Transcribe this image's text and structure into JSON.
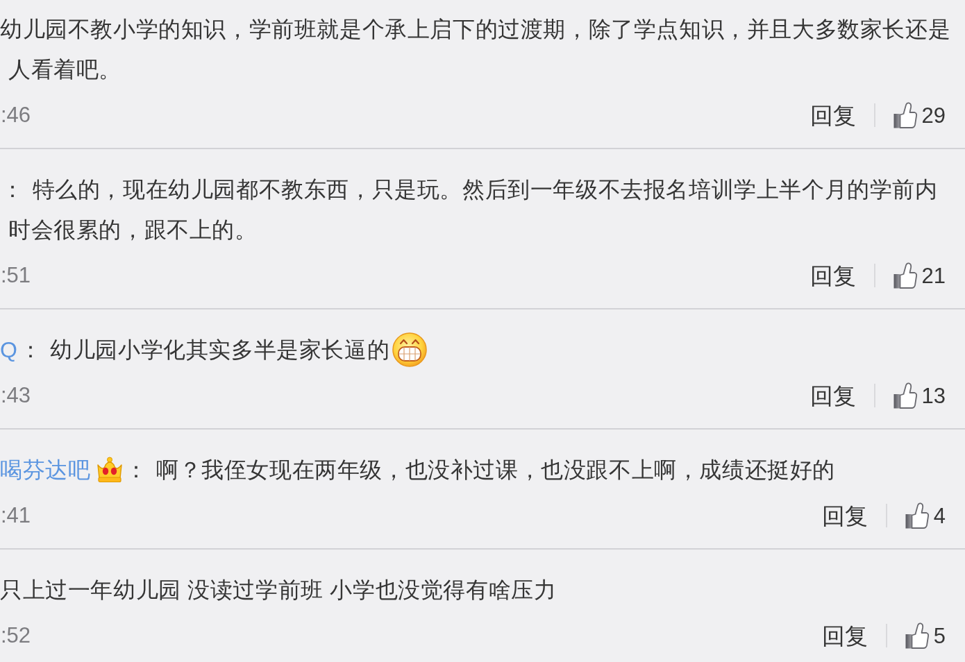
{
  "comments": [
    {
      "lines": [
        [
          {
            "kind": "text",
            "text": "幼儿园不教小学的知识，学前班就是个承上启下的过渡期，除了学点知识，并且大多数家长还是"
          }
        ],
        [
          {
            "kind": "text",
            "text": "人看着吧。"
          }
        ]
      ],
      "time": ":46",
      "reply": "回复",
      "likes": "29"
    },
    {
      "lines": [
        [
          {
            "kind": "colon",
            "text": "："
          },
          {
            "kind": "text",
            "text": "特么的，现在幼儿园都不教东西，只是玩。然后到一年级不去报名培训学上半个月的学前内"
          }
        ],
        [
          {
            "kind": "text",
            "text": "时会很累的，跟不上的。"
          }
        ]
      ],
      "time": ":51",
      "reply": "回复",
      "likes": "21"
    },
    {
      "lines": [
        [
          {
            "kind": "user",
            "text": "Q"
          },
          {
            "kind": "colon",
            "text": "："
          },
          {
            "kind": "text",
            "text": "幼儿园小学化其实多半是家长逼的"
          },
          {
            "kind": "emoji"
          }
        ]
      ],
      "time": ":43",
      "reply": "回复",
      "likes": "13"
    },
    {
      "lines": [
        [
          {
            "kind": "user",
            "text": "喝芬达吧"
          },
          {
            "kind": "badge"
          },
          {
            "kind": "colon",
            "text": "："
          },
          {
            "kind": "text",
            "text": "啊？我侄女现在两年级，也没补过课，也没跟不上啊，成绩还挺好的"
          }
        ]
      ],
      "time": ":41",
      "reply": "回复",
      "likes": "4"
    },
    {
      "lines": [
        [
          {
            "kind": "text",
            "text": "只上过一年幼儿园 没读过学前班 小学也没觉得有啥压力"
          }
        ]
      ],
      "time": ":52",
      "reply": "回复",
      "likes": "5"
    }
  ]
}
